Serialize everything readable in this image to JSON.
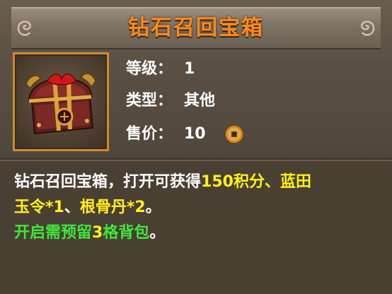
{
  "item": {
    "title": "钻石召回宝箱",
    "icon": "treasure-chest-icon"
  },
  "attributes": {
    "level_label": "等级：",
    "level_value": "1",
    "type_label": "类型：",
    "type_value": "其他",
    "price_label": "售价：",
    "price_value": "10",
    "price_currency_icon": "copper-coin-icon"
  },
  "description": {
    "line1_white": "钻石召回宝箱，打开可获得",
    "line1_yellow": "150积分、蓝田",
    "line2_yellow_a": "玉令*1",
    "line2_white_a": "、",
    "line2_yellow_b": "根骨丹*2",
    "line2_white_b": "。",
    "line3_green_a": "开启需预留",
    "line3_yellow": "3",
    "line3_green_b": "格背包",
    "line3_white": "。"
  },
  "colors": {
    "title": "#ff8a1c",
    "highlight_yellow": "#fff21a",
    "highlight_green": "#3ee83a",
    "frame_orange": "#d28a2a"
  }
}
